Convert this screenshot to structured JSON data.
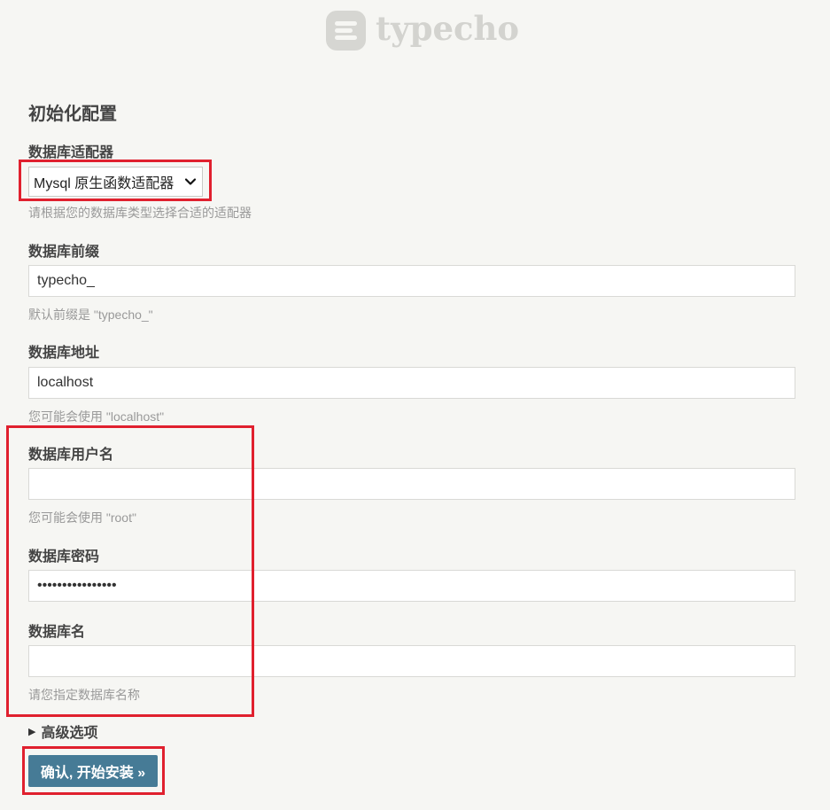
{
  "header": {
    "logo_text": "typecho"
  },
  "page": {
    "title": "初始化配置"
  },
  "form": {
    "adapter": {
      "label": "数据库适配器",
      "value": "Mysql 原生函数适配器",
      "hint": "请根据您的数据库类型选择合适的适配器"
    },
    "prefix": {
      "label": "数据库前缀",
      "value": "typecho_",
      "hint": "默认前缀是 \"typecho_\""
    },
    "host": {
      "label": "数据库地址",
      "value": "localhost",
      "hint": "您可能会使用 \"localhost\""
    },
    "user": {
      "label": "数据库用户名",
      "value": "",
      "hint": "您可能会使用 \"root\""
    },
    "password": {
      "label": "数据库密码",
      "value": "••••••••••••••••"
    },
    "dbname": {
      "label": "数据库名",
      "value": "",
      "hint": "请您指定数据库名称"
    },
    "advanced_label": "高级选项",
    "submit_label": "确认, 开始安装 »"
  },
  "colors": {
    "background": "#f6f6f3",
    "button": "#467b96",
    "highlight": "#e0202e",
    "hint": "#999999"
  }
}
